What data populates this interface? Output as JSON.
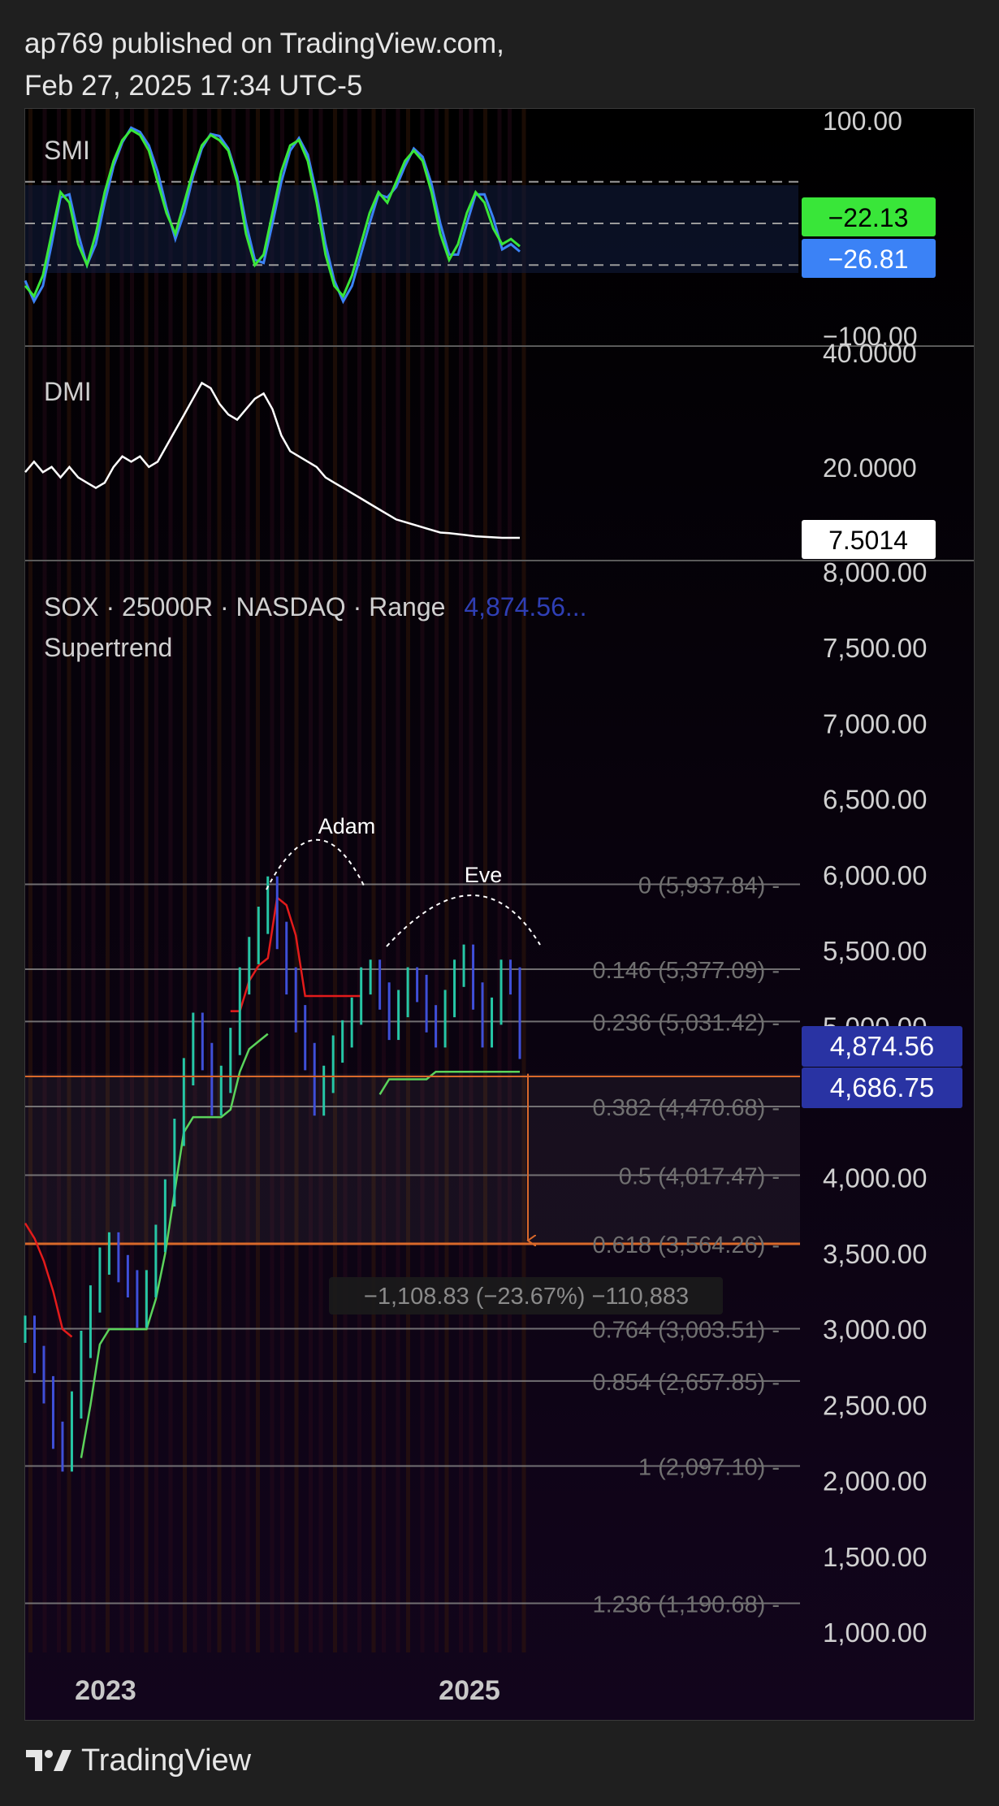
{
  "header": {
    "line1": "ap769 published on TradingView.com,",
    "line2": "Feb 27, 2025 17:34 UTC-5"
  },
  "footer": {
    "brand": "TradingView"
  },
  "colors": {
    "background": "#000000",
    "page": "#1f1f1f",
    "smi_line": "#39e639",
    "smi_signal": "#3b82f6",
    "dmi_line": "#ffffff",
    "candle_up": "#26c6a6",
    "candle_down": "#3f4fd8",
    "supertrend_up": "#5bd35b",
    "supertrend_down": "#e31b1b",
    "fib_line": "#8a8a8a",
    "fib_highlight": "#d9692a",
    "price_badge": "#2933a3"
  },
  "chart_data": [
    {
      "type": "line",
      "title": "SMI",
      "ylim": [
        -100,
        100
      ],
      "y_ticks": [
        "100.00",
        "−100.00"
      ],
      "dashed_levels": [
        40,
        0,
        -40
      ],
      "x_range": [
        "2022-05",
        "2025-02"
      ],
      "series": [
        {
          "name": "",
          "color": "#39e639",
          "values": [
            -60,
            -70,
            -50,
            -10,
            30,
            20,
            -20,
            -40,
            -10,
            30,
            60,
            80,
            90,
            85,
            70,
            40,
            10,
            -10,
            20,
            50,
            75,
            85,
            80,
            70,
            40,
            -10,
            -40,
            -30,
            10,
            50,
            75,
            80,
            60,
            20,
            -30,
            -60,
            -70,
            -50,
            -20,
            10,
            30,
            20,
            40,
            60,
            70,
            60,
            30,
            -10,
            -35,
            -20,
            10,
            30,
            20,
            -5,
            -20,
            -15,
            -22
          ],
          "last_value": "−22.13"
        },
        {
          "name": "",
          "color": "#3b82f6",
          "values": [
            -55,
            -75,
            -60,
            -20,
            25,
            28,
            -10,
            -40,
            -20,
            20,
            55,
            78,
            92,
            88,
            75,
            50,
            15,
            -15,
            10,
            45,
            72,
            86,
            84,
            72,
            45,
            0,
            -35,
            -38,
            0,
            40,
            70,
            82,
            66,
            28,
            -20,
            -55,
            -75,
            -60,
            -30,
            0,
            28,
            25,
            35,
            55,
            72,
            64,
            38,
            0,
            -30,
            -30,
            0,
            28,
            28,
            5,
            -25,
            -20,
            -27
          ],
          "last_value": "−26.81"
        }
      ]
    },
    {
      "type": "line",
      "title": "DMI",
      "ylim": [
        8,
        40
      ],
      "y_ticks": [
        "40.0000",
        "20.0000"
      ],
      "x_range": [
        "2022-05",
        "2025-02"
      ],
      "series": [
        {
          "name": "",
          "color": "#ffffff",
          "values": [
            20,
            22,
            20,
            21,
            19,
            21,
            19,
            18,
            17,
            18,
            21,
            23,
            22,
            23,
            21,
            22,
            25,
            28,
            31,
            34,
            37,
            36,
            33,
            31,
            30,
            32,
            34,
            35,
            32,
            27,
            24,
            23,
            22,
            21,
            19,
            18,
            17,
            16,
            15,
            14,
            13,
            12,
            11,
            10.5,
            10,
            9.5,
            9,
            8.5,
            8.4,
            8.2,
            8,
            7.8,
            7.7,
            7.6,
            7.5,
            7.5,
            7.5014
          ],
          "last_value": "7.5014"
        }
      ]
    },
    {
      "type": "line",
      "title": "SOX · 25000R · NASDAQ · Range",
      "last_price_label": "4,874.56...",
      "subtitle": "Supertrend",
      "ylim": [
        770,
        8000
      ],
      "y_ticks": [
        "8,000.00",
        "7,500.00",
        "7,000.00",
        "6,500.00",
        "6,000.00",
        "5,500.00",
        "5,000.00",
        "4,000.00",
        "3,500.00",
        "3,000.00",
        "2,500.00",
        "2,000.00",
        "1,500.00",
        "1,000.00"
      ],
      "x_ticks": [
        "2023",
        "2025"
      ],
      "series": [
        {
          "name": "SOX",
          "color": "#26c6a6",
          "values": [
            3000,
            2800,
            2600,
            2300,
            2150,
            2500,
            2900,
            3200,
            3450,
            3550,
            3400,
            3300,
            3100,
            3300,
            3600,
            3900,
            4300,
            4700,
            5000,
            4800,
            4500,
            4650,
            4900,
            5300,
            5500,
            5700,
            5900,
            5600,
            5300,
            5050,
            4800,
            4500,
            4650,
            4850,
            4950,
            5100,
            5300,
            5350,
            5200,
            5000,
            5150,
            5300,
            5250,
            5050,
            4950,
            5150,
            5350,
            5450,
            5200,
            4950,
            5100,
            5350,
            5300,
            4874.56
          ]
        },
        {
          "name": "Supertrend",
          "color": "#5bd35b",
          "values": [
            null,
            null,
            null,
            null,
            null,
            null,
            2150,
            2500,
            2900,
            3000,
            3000,
            3000,
            3000,
            3000,
            3200,
            3500,
            3900,
            4300,
            4400,
            4400,
            4400,
            4400,
            4450,
            4700,
            4850,
            4900,
            4950,
            null,
            null,
            null,
            null,
            null,
            null,
            null,
            null,
            null,
            null,
            null,
            4550,
            4650,
            4650,
            4650,
            4650,
            4650,
            4700,
            4700,
            4700,
            4700,
            4700,
            4700,
            4700,
            4700,
            4700,
            4700
          ]
        },
        {
          "name": "Supertrend",
          "color": "#e31b1b",
          "values": [
            3700,
            3600,
            3450,
            3250,
            3000,
            2950,
            null,
            null,
            null,
            null,
            null,
            null,
            null,
            null,
            null,
            null,
            null,
            null,
            null,
            null,
            null,
            null,
            5100,
            5100,
            5300,
            5400,
            5450,
            5850,
            5800,
            5600,
            5200,
            5200,
            5200,
            5200,
            5200,
            5200,
            5200,
            null,
            null,
            null,
            null,
            null,
            null,
            null,
            null,
            null,
            null,
            null,
            null,
            null,
            null,
            null,
            null,
            null
          ]
        }
      ],
      "price_labels": [
        "4,874.56",
        "4,686.75"
      ],
      "fibonacci": [
        {
          "level": "0",
          "price": 5937.84,
          "label": "0 (5,937.84)"
        },
        {
          "level": "0.146",
          "price": 5377.09,
          "label": "0.146 (5,377.09)"
        },
        {
          "level": "0.236",
          "price": 5031.42,
          "label": "0.236 (5,031.42)"
        },
        {
          "level": "0.382",
          "price": 4470.68,
          "label": "0.382 (4,470.68)"
        },
        {
          "level": "0.5",
          "price": 4017.47,
          "label": "0.5 (4,017.47)"
        },
        {
          "level": "0.618",
          "price": 3564.26,
          "label": "0.618 (3,564.26)"
        },
        {
          "level": "0.764",
          "price": 3003.51,
          "label": "0.764 (3,003.51)"
        },
        {
          "level": "0.854",
          "price": 2657.85,
          "label": "0.854 (2,657.85)"
        },
        {
          "level": "1",
          "price": 2097.1,
          "label": "1 (2,097.10)"
        },
        {
          "level": "1.236",
          "price": 1190.68,
          "label": "1.236 (1,190.68)"
        }
      ],
      "annotations": [
        "Adam",
        "Eve"
      ],
      "measure": {
        "from": 4686.75,
        "to": 3564.26,
        "label": "−1,108.83 (−23.67%) −110,883"
      }
    }
  ]
}
